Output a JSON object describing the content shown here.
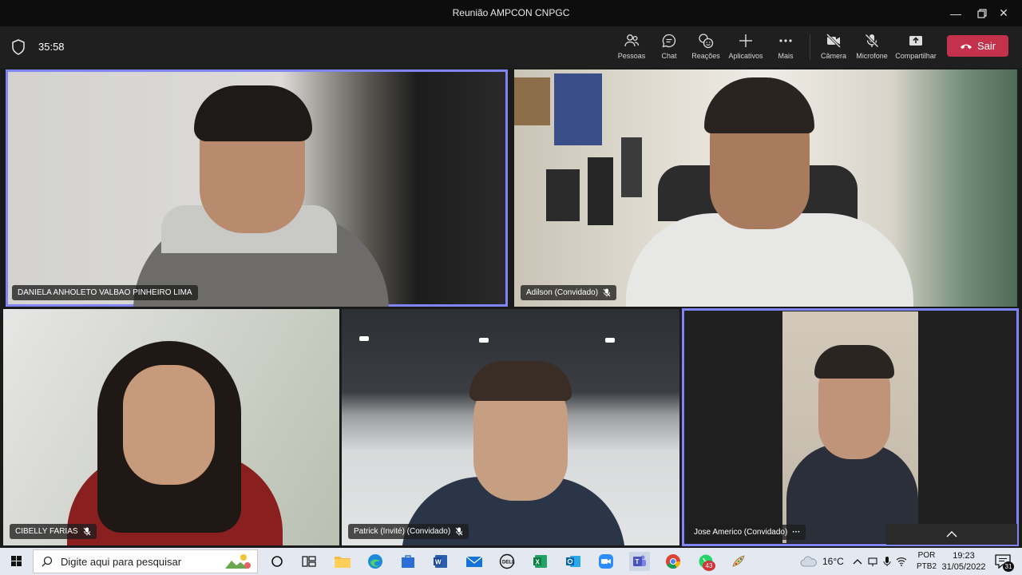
{
  "window": {
    "title": "Reunião AMPCON CNPGC"
  },
  "toolbar": {
    "timer": "35:58",
    "buttons": [
      {
        "label": "Pessoas",
        "icon": "people-icon"
      },
      {
        "label": "Chat",
        "icon": "chat-icon"
      },
      {
        "label": "Reações",
        "icon": "reactions-icon"
      },
      {
        "label": "Aplicativos",
        "icon": "apps-icon"
      },
      {
        "label": "Mais",
        "icon": "more-icon"
      },
      {
        "label": "Câmera",
        "icon": "camera-off-icon"
      },
      {
        "label": "Microfone",
        "icon": "mic-off-icon"
      },
      {
        "label": "Compartilhar",
        "icon": "share-icon"
      }
    ],
    "leave_label": "Sair",
    "leave_color": "#c4314b"
  },
  "participants": [
    {
      "name": "DANIELA ANHOLETO VALBAO PINHEIRO LIMA",
      "muted": false,
      "active": true
    },
    {
      "name": "Adilson (Convidado)",
      "muted": true,
      "active": false
    },
    {
      "name": "CIBELLY FARIAS",
      "muted": true,
      "active": false
    },
    {
      "name": "Patrick (Invité) (Convidado)",
      "muted": true,
      "active": false
    },
    {
      "name": "Jose Americo (Convidado)",
      "muted": false,
      "active": true,
      "more": "···"
    }
  ],
  "accent_color": "#7f85f5",
  "taskbar": {
    "search_placeholder": "Digite aqui para pesquisar",
    "weather": "16°C",
    "lang_top": "POR",
    "lang_bottom": "PTB2",
    "time": "19:23",
    "date": "31/05/2022",
    "whatsapp_badge": "43",
    "notification_count": "31"
  }
}
